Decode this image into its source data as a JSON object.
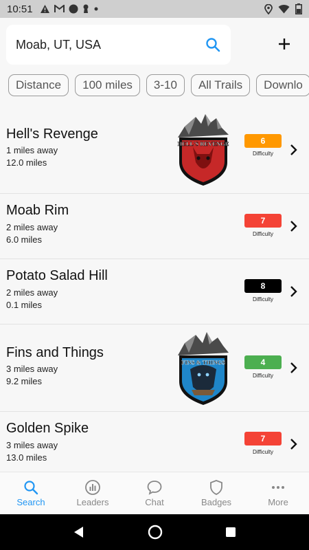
{
  "status_bar": {
    "time": "10:51",
    "icons": [
      "alert-icon",
      "gmail-icon",
      "circle-icon",
      "keyhole-icon",
      "dot-icon"
    ],
    "right_icons": [
      "location-icon",
      "wifi-icon",
      "battery-icon"
    ]
  },
  "search": {
    "location": "Moab, UT, USA"
  },
  "filters": [
    "Distance",
    "100 miles",
    "3-10",
    "All Trails",
    "Downlo"
  ],
  "trails": [
    {
      "name": "Hell's Revenge",
      "distance_away": "1 miles away",
      "length": "12.0 miles",
      "difficulty": "6",
      "difficulty_label": "Difficulty",
      "color": "#ff9800",
      "logo_text": "HELL'S REVENGE",
      "has_logo": true
    },
    {
      "name": "Moab Rim",
      "distance_away": "2 miles away",
      "length": "6.0 miles",
      "difficulty": "7",
      "difficulty_label": "Difficulty",
      "color": "#f44336",
      "has_logo": false
    },
    {
      "name": "Potato Salad Hill",
      "distance_away": "2 miles away",
      "length": "0.1 miles",
      "difficulty": "8",
      "difficulty_label": "Difficulty",
      "color": "#000000",
      "has_logo": false
    },
    {
      "name": "Fins and Things",
      "distance_away": "3 miles away",
      "length": "9.2 miles",
      "difficulty": "4",
      "difficulty_label": "Difficulty",
      "color": "#4caf50",
      "logo_text": "FINS & THINGS",
      "has_logo": true
    },
    {
      "name": "Golden Spike",
      "distance_away": "3 miles away",
      "length": "13.0 miles",
      "difficulty": "7",
      "difficulty_label": "Difficulty",
      "color": "#f44336",
      "has_logo": false
    }
  ],
  "tabs": [
    {
      "label": "Search",
      "icon": "search-icon",
      "active": true
    },
    {
      "label": "Leaders",
      "icon": "bar-chart-icon",
      "active": false
    },
    {
      "label": "Chat",
      "icon": "chat-bubble-icon",
      "active": false
    },
    {
      "label": "Badges",
      "icon": "shield-icon",
      "active": false
    },
    {
      "label": "More",
      "icon": "more-dots-icon",
      "active": false
    }
  ],
  "colors": {
    "accent": "#2196f3"
  }
}
